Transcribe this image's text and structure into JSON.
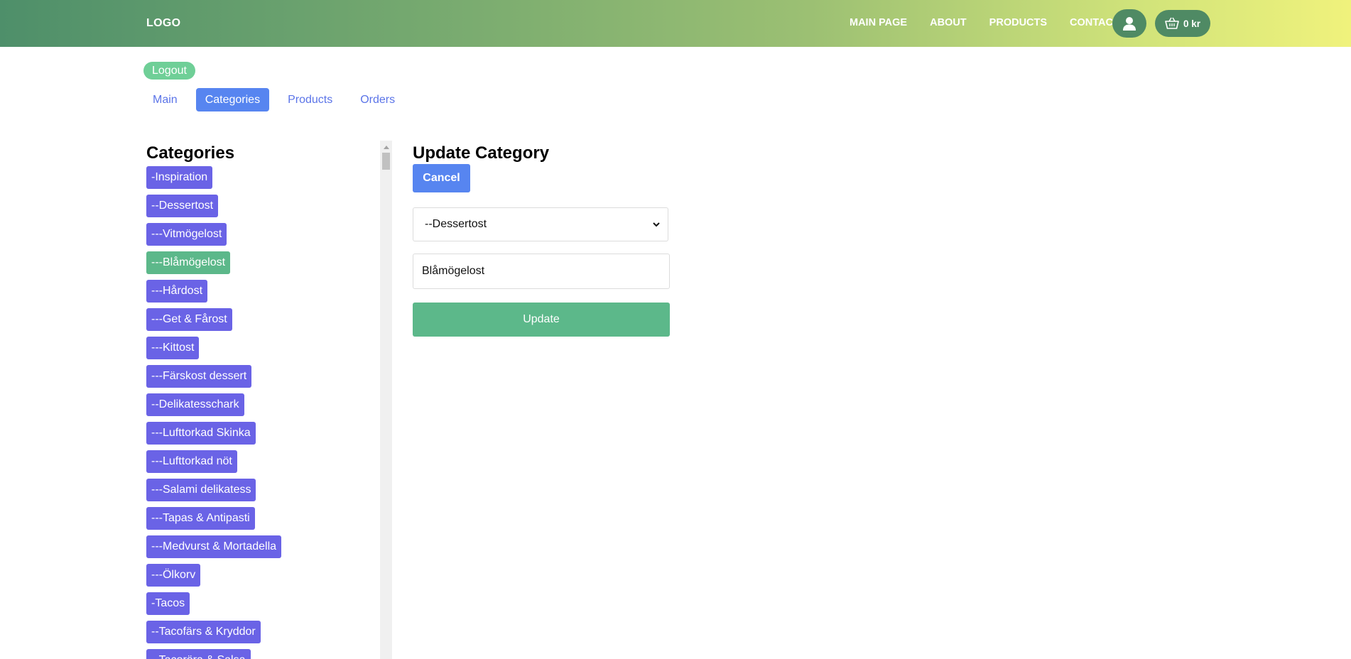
{
  "header": {
    "logo": "LOGO",
    "nav": [
      "MAIN PAGE",
      "ABOUT",
      "PRODUCTS",
      "CONTACT"
    ],
    "user_icon": "user-icon",
    "cart_icon": "basket-icon",
    "cart_total": "0 kr"
  },
  "admin": {
    "logout_label": "Logout",
    "tabs": [
      "Main",
      "Categories",
      "Products",
      "Orders"
    ],
    "active_tab": "Categories"
  },
  "categories": {
    "title": "Categories",
    "items": [
      "-Inspiration",
      "--Dessertost",
      "---Vitmögelost",
      "---Blåmögelost",
      "---Hårdost",
      "---Get & Fårost",
      "---Kittost",
      "---Färskost dessert",
      "--Delikatesschark",
      "---Lufttorkad Skinka",
      "---Lufttorkad nöt",
      "---Salami delikatess",
      "---Tapas & Antipasti",
      "---Medvurst & Mortadella",
      "---Ölkorv",
      "-Tacos",
      "--Tacofärs & Kryddor",
      "--Tacoröra & Salsa"
    ],
    "selected": "---Blåmögelost"
  },
  "update_form": {
    "title": "Update Category",
    "cancel_label": "Cancel",
    "parent_value": "--Dessertost",
    "name_value": "Blåmögelost",
    "submit_label": "Update"
  },
  "colors": {
    "category_button": "#6a63e6",
    "selected_category": "#5cb88a",
    "primary_button": "#5785f0",
    "update_button": "#5cb88a"
  }
}
